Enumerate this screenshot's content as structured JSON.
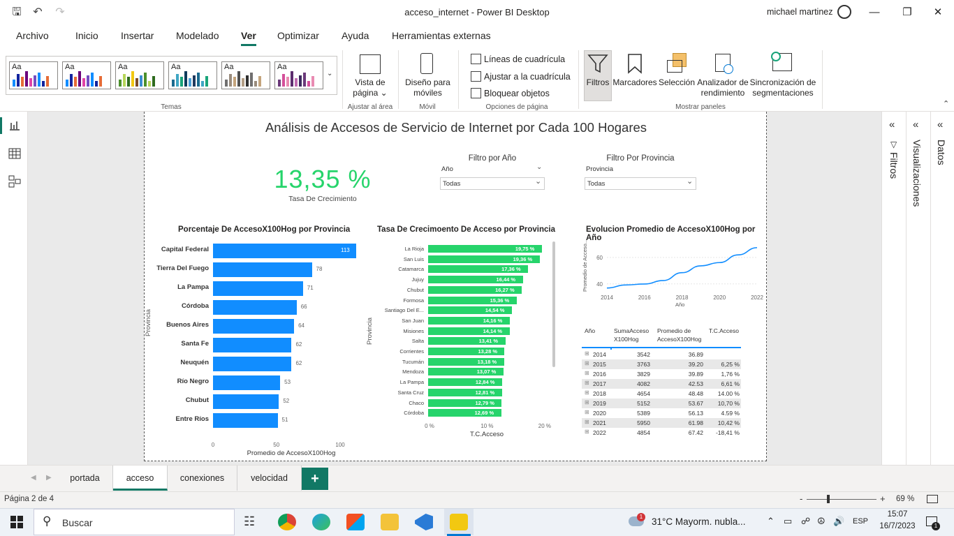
{
  "window": {
    "title": "acceso_internet - Power BI Desktop",
    "user": "michael martinez"
  },
  "menu": {
    "tabs": [
      "Archivo",
      "Inicio",
      "Insertar",
      "Modelado",
      "Ver",
      "Optimizar",
      "Ayuda",
      "Herramientas externas"
    ],
    "active": "Ver"
  },
  "ribbon": {
    "themes_label": "Temas",
    "vista": {
      "line1": "Vista de",
      "line2": "página",
      "group": "Ajustar al área"
    },
    "movil": {
      "line1": "Diseño para",
      "line2": "móviles",
      "group": "Móvil"
    },
    "opciones": {
      "items": [
        "Líneas de cuadrícula",
        "Ajustar a la cuadrícula",
        "Bloquear objetos"
      ],
      "group": "Opciones de página"
    },
    "panels": {
      "items": [
        {
          "label1": "Filtros",
          "label2": ""
        },
        {
          "label1": "Marcadores",
          "label2": ""
        },
        {
          "label1": "Selección",
          "label2": ""
        },
        {
          "label1": "Analizador de",
          "label2": "rendimiento"
        },
        {
          "label1": "Sincronización de",
          "label2": "segmentaciones"
        }
      ],
      "group": "Mostrar paneles"
    },
    "theme_colors": [
      [
        "#118dff",
        "#12239e",
        "#e66c37",
        "#6b007b",
        "#e044a7",
        "#744ec2"
      ],
      [
        "#118dff",
        "#12239e",
        "#e66c37",
        "#6b007b",
        "#e044a7",
        "#744ec2"
      ],
      [
        "#4b8f2b",
        "#b7d65a",
        "#2e6b1e",
        "#f2c811",
        "#7b4d2a",
        "#3a8ccf"
      ],
      [
        "#1b6a8f",
        "#3fa6c4",
        "#19a47a",
        "#0e3b5c",
        "#4aa0d8",
        "#203a5e"
      ],
      [
        "#706f6f",
        "#9a8c7d",
        "#c4a47c",
        "#505050",
        "#b39e85",
        "#2f2f2f"
      ],
      [
        "#6b3a7a",
        "#d4509a",
        "#e98bb2",
        "#5c2d6e",
        "#c06bb0",
        "#3e2a5e"
      ]
    ]
  },
  "report": {
    "title": "Análisis de Accesos de Servicio de Internet por Cada 100 Hogares",
    "kpi": {
      "value": "13,35 %",
      "label": "Tasa De Crecimiento"
    },
    "filter_year": {
      "title": "Filtro por Año",
      "field": "Año",
      "value": "Todas"
    },
    "filter_prov": {
      "title": "Filtro Por Provincia",
      "field": "Provincia",
      "value": "Todas"
    }
  },
  "chart_data": [
    {
      "type": "bar",
      "title": "Porcentaje De AccesoX100Hog por Provincia",
      "xlabel": "Promedio de AccesoX100Hog",
      "ylabel": "Provincia",
      "categories": [
        "Capital Federal",
        "Tierra Del Fuego",
        "La Pampa",
        "Córdoba",
        "Buenos Aires",
        "Santa Fe",
        "Neuquén",
        "Río Negro",
        "Chubut",
        "Entre Ríos"
      ],
      "values": [
        113,
        78,
        71,
        66,
        64,
        62,
        62,
        53,
        52,
        51
      ],
      "xticks": [
        "0",
        "50",
        "100"
      ],
      "xlim": [
        0,
        113
      ],
      "color": "#118dff"
    },
    {
      "type": "bar",
      "title": "Tasa De Crecimoento De Acceso por Provincia",
      "xlabel": "T.C.Acceso",
      "ylabel": "Provincia",
      "categories": [
        "La Rioja",
        "San Luis",
        "Catamarca",
        "Jujuy",
        "Chubut",
        "Formosa",
        "Santiago Del E...",
        "San Juan",
        "Misiones",
        "Salta",
        "Corrientes",
        "Tucumán",
        "Mendoza",
        "La Pampa",
        "Santa Cruz",
        "Chaco",
        "Córdoba"
      ],
      "values": [
        19.75,
        19.36,
        17.36,
        16.44,
        16.27,
        15.36,
        14.54,
        14.16,
        14.14,
        13.41,
        13.28,
        13.18,
        13.07,
        12.84,
        12.81,
        12.79,
        12.69
      ],
      "labels": [
        "19,75 %",
        "19,36 %",
        "17,36 %",
        "16,44 %",
        "16,27 %",
        "15,36 %",
        "14,54 %",
        "14,16 %",
        "14,14 %",
        "13,41 %",
        "13,28 %",
        "13,18 %",
        "13,07 %",
        "12,84 %",
        "12,81 %",
        "12,79 %",
        "12,69 %"
      ],
      "xticks": [
        "0 %",
        "10 %",
        "20 %"
      ],
      "xlim": [
        0,
        20
      ],
      "color": "#26d46b"
    },
    {
      "type": "line",
      "title": "Evolucion Promedio de AccesoX100Hog por Año",
      "xlabel": "Año",
      "ylabel": "Promedio de Acceso...",
      "x": [
        2014,
        2015,
        2016,
        2017,
        2018,
        2019,
        2020,
        2021,
        2022
      ],
      "values": [
        36.89,
        39.2,
        39.89,
        42.53,
        48.48,
        53.67,
        56.13,
        61.98,
        67.42
      ],
      "xticks": [
        "2014",
        "2016",
        "2018",
        "2020",
        "2022"
      ],
      "yticks": [
        "40",
        "60"
      ],
      "xlim": [
        2014,
        2022
      ],
      "ylim": [
        33,
        70
      ],
      "color": "#118dff"
    },
    {
      "type": "table",
      "columns": [
        "Año",
        "SumaAcceso X100Hog",
        "Promedio de AccesoX100Hog",
        "T.C.Acceso"
      ],
      "rows": [
        [
          "2014",
          "3542",
          "36.89",
          ""
        ],
        [
          "2015",
          "3763",
          "39.20",
          "6,25 %"
        ],
        [
          "2016",
          "3829",
          "39.89",
          "1,76 %"
        ],
        [
          "2017",
          "4082",
          "42.53",
          "6,61 %"
        ],
        [
          "2018",
          "4654",
          "48.48",
          "14.00 %"
        ],
        [
          "2019",
          "5152",
          "53.67",
          "10,70 %"
        ],
        [
          "2020",
          "5389",
          "56.13",
          "4.59 %"
        ],
        [
          "2021",
          "5950",
          "61.98",
          "10,42 %"
        ],
        [
          "2022",
          "4854",
          "67.42",
          "-18,41 %"
        ]
      ]
    }
  ],
  "panes": {
    "filtros": "Filtros",
    "visualizaciones": "Visualizaciones",
    "datos": "Datos"
  },
  "pages": {
    "tabs": [
      "portada",
      "acceso",
      "conexiones",
      "velocidad"
    ],
    "active": "acceso",
    "add": "+"
  },
  "status": {
    "page": "Página 2 de 4",
    "zoom": "69 %",
    "minus": "-",
    "plus": "+"
  },
  "taskbar": {
    "search": "Buscar",
    "weather": "31°C  Mayorm. nubla...",
    "lang": "ESP",
    "time": "15:07",
    "date": "16/7/2023",
    "badge": "1",
    "notif": "1"
  }
}
